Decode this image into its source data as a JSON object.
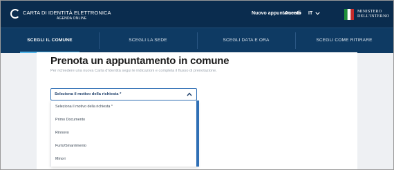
{
  "header": {
    "brand_title": "CARTA DI IDENTITÀ ELETTRONICA",
    "brand_subtitle": "AGENDA ONLINE",
    "new_appointment": "Nuovo appuntamento",
    "login": "Accedi",
    "language": "IT",
    "ministry_line1": "MINISTERO",
    "ministry_line2": "DELL'INTERNO"
  },
  "steps": [
    {
      "label": "SCEGLI IL COMUNE",
      "active": true
    },
    {
      "label": "SCEGLI LA SEDE",
      "active": false
    },
    {
      "label": "SCEGLI DATA E ORA",
      "active": false
    },
    {
      "label": "SCEGLI COME RITIRARE",
      "active": false
    }
  ],
  "main": {
    "title": "Prenota un appuntamento in comune",
    "intro": "Per richiedere una nuova Carta d'Identità segui le indicazioni e completa il flusso di prenotazione.",
    "select": {
      "label": "Seleziona il motivo della richiesta *",
      "options": [
        "Seleziona il motivo della richiesta *",
        "Primo Documento",
        "Rinnovo",
        "Furto/Smarrimento",
        "Minori"
      ]
    }
  },
  "colors": {
    "header_bg": "#0a2c4e",
    "steps_bg": "#0e3a63",
    "active_underline": "#4fb3e8",
    "accent": "#2f6fb5"
  },
  "icons": [
    "id-card-logo-icon",
    "chevron-down-icon",
    "chevron-up-icon",
    "italian-flag-emblem-icon"
  ]
}
